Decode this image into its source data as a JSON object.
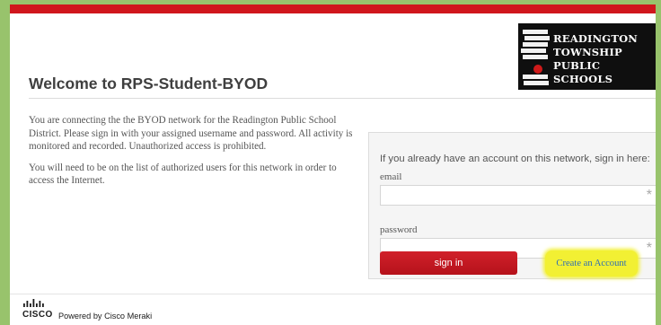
{
  "header": {
    "logo_lines": [
      "READINGTON",
      "TOWNSHIP",
      "PUBLIC SCHOOLS"
    ]
  },
  "welcome_title": "Welcome to RPS-Student-BYOD",
  "intro": {
    "paragraph1": "You are connecting the the BYOD network for the Readington Public School District. Please sign in with your assigned username and password. All activity is monitored and recorded. Unauthorized access is prohibited.",
    "paragraph2": "You will need to be on the list of authorized users for this network in order to access the Internet."
  },
  "signin_panel": {
    "lead_text": "If you already have an account on this network, sign in here:",
    "email_label": "email",
    "email_value": "",
    "password_label": "password",
    "password_value": "",
    "required_marker": "*",
    "signin_label": "sign in",
    "create_account_label": "Create an Account"
  },
  "footer": {
    "brand": "CISCO",
    "powered_by": "Powered by Cisco Meraki"
  },
  "colors": {
    "accent_red": "#d0161d",
    "highlight_yellow": "#f2f033",
    "link_blue": "#2f6fb4",
    "outer_green": "#98c36c"
  }
}
